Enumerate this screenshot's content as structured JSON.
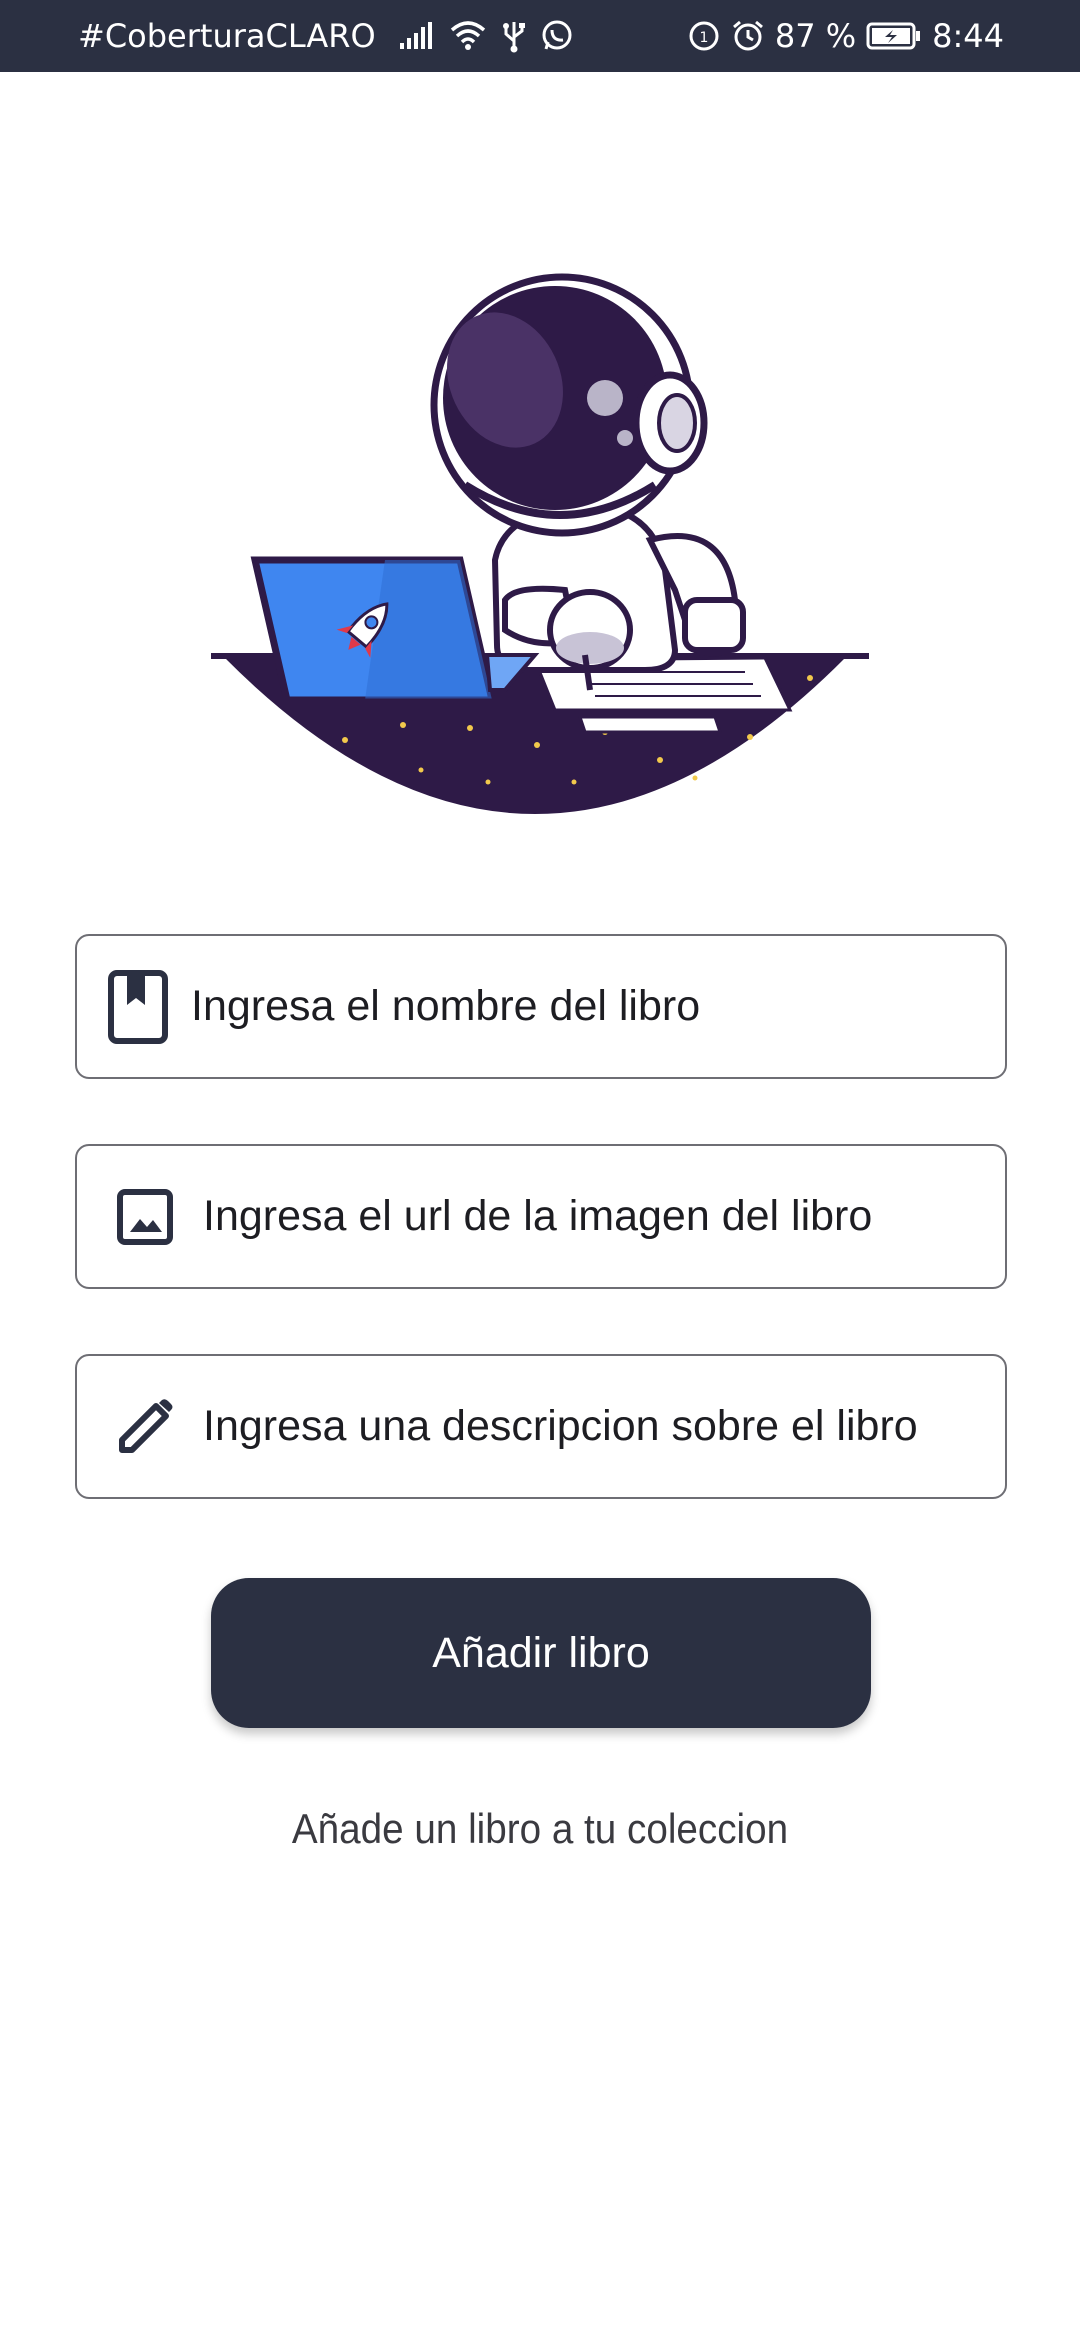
{
  "status_bar": {
    "carrier": "#CoberturaCLARO",
    "battery": "87 %",
    "time": "8:44"
  },
  "form": {
    "book_name_placeholder": "Ingresa el nombre del libro",
    "book_image_placeholder": "Ingresa el url de la imagen del libro",
    "book_description_placeholder": "Ingresa una descripcion sobre el libro",
    "add_button_label": "Añadir libro"
  },
  "footer": {
    "caption": "Añade un libro a tu coleccion"
  },
  "icons": {
    "book_field": "bookmark-book-icon",
    "image_field": "image-icon",
    "description_field": "pencil-icon"
  },
  "colors": {
    "primary": "#2b3042",
    "illustration_dark": "#2e1a47",
    "laptop_blue": "#3f86f0"
  }
}
